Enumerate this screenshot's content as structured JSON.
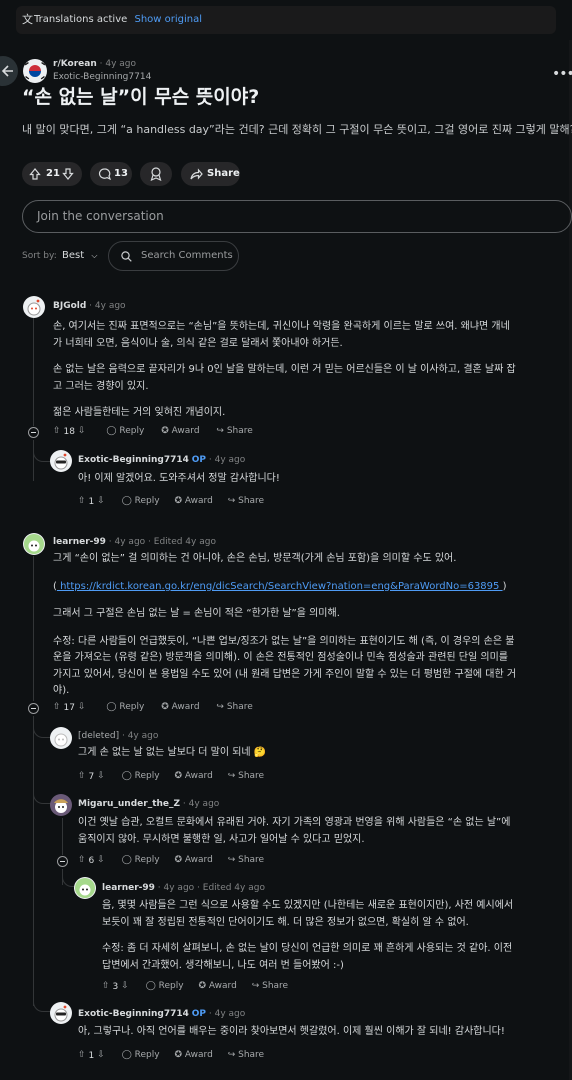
{
  "translation_bar": {
    "label": "Translations active",
    "link": "Show original"
  },
  "post": {
    "subreddit": "r/Korean",
    "time": "4y ago",
    "author": "Exotic-Beginning7714",
    "title": "“손 없는 날”이 무슨 뜻이야?",
    "body": "내 말이 맞다면, 그게 “a handless day”라는 건데? 근데 정확히 그 구절이 무슨 뜻이고, 그걸 영어로 진짜 그렇게 말해?",
    "votes": "21",
    "comments": "13",
    "share_label": "Share"
  },
  "join_placeholder": "Join the conversation",
  "sort": {
    "label": "Sort by:",
    "value": "Best"
  },
  "search_placeholder": "Search Comments",
  "actions": {
    "reply": "Reply",
    "award": "Award",
    "share": "Share"
  },
  "comments": [
    {
      "author": "BJGold",
      "time": "4y ago",
      "op": "",
      "edited": "",
      "lines": [
        "손, 여기서는 진짜 표면적으로는 “손님”을 뜻하는데, 귀신이나 악령을 완곡하게 이르는 말로 쓰여. 왜냐면 개네",
        "가 너희테 오면, 음식이나 술, 의식 같은 걸로 달래서 쫓아내야 하거든.",
        "",
        "손 없는 날은 음력으로 끝자리가 9나 0인 날을 말하는데, 이런 거 믿는 어르신들은 이 날 이사하고, 결혼 날짜 잡",
        "고 그러는 경향이 있지.",
        "",
        "젊은 사람들한테는 거의 잊혀진 개념이지."
      ],
      "votes": "18"
    },
    {
      "author": "Exotic-Beginning7714",
      "time": "4y ago",
      "op": "OP",
      "edited": "",
      "lines": [
        "아! 이제 알겠어요. 도와주셔서 정말 감사합니다!"
      ],
      "votes": "1"
    },
    {
      "author": "learner-99",
      "time": "4y ago",
      "op": "",
      "edited": "Edited 4y ago",
      "lines": [
        "그게 “손이 없는” 걸 의미하는 건 아니야, 손은 손님, 방문객(가게 손님 포함)을 의미할 수도 있어.",
        "",
        "(https://krdict.korean.go.kr/eng/dicSearch/SearchView?nation=eng&ParaWordNo=63895)",
        "",
        "그래서 그 구절은 손님 없는 날 = 손님이 적은 “한가한 날”을 의미해.",
        "",
        "수정: 다른 사람들이 언급했듯이, “나쁜 업보/징조가 없는 날”을 의미하는 표현이기도 해 (즉, 이 경우의 손은 불",
        "운을 가져오는 (유령 같은) 방문객을 의미해). 이 손은 전통적인 점성술이나 민속 점성술과 관련된 단일 의미를",
        "가지고 있어서, 당신이 본 용법일 수도 있어 (내 원래 답변은 가게 주인이 말할 수 있는 더 평범한 구절에 대한 거",
        "야)."
      ],
      "link": " https://krdict.korean.go.kr/eng/dicSearch/SearchView?nation=eng&ParaWordNo=63895 ",
      "votes": "17"
    },
    {
      "author": "[deleted]",
      "time": "4y ago",
      "op": "",
      "edited": "",
      "lines": [
        "그게 손 없는 날 없는 날보다 더 말이 되네 🤔"
      ],
      "votes": "7"
    },
    {
      "author": "Migaru_under_the_Z",
      "time": "4y ago",
      "op": "",
      "edited": "",
      "lines": [
        "이건 옛날 습관, 오컬트 문화에서 유래된 거야. 자기 가족의 영광과 번영을 위해 사람들은 “손 없는 날”에",
        "움직이지 않아. 무시하면 불행한 일, 사고가 일어날 수 있다고 믿었지."
      ],
      "votes": "6"
    },
    {
      "author": "learner-99",
      "time": "4y ago",
      "op": "",
      "edited": "Edited 4y ago",
      "lines": [
        "음, 몇몇 사람들은 그런 식으로 사용할 수도 있겠지만 (나한테는 새로운 표현이지만), 사전 예시에서",
        "보듯이 꽤 잘 정립된 전통적인 단어이기도 해. 더 많은 정보가 없으면, 확실히 알 수 없어.",
        "",
        "수정: 좀 더 자세히 살펴보니, 손 없는 날이 당신이 언급한 의미로 꽤 흔하게 사용되는 것 같아. 이전",
        "답변에서 간과했어. 생각해보니, 나도 여러 번 들어봤어 :-)"
      ],
      "votes": "3"
    },
    {
      "author": "Exotic-Beginning7714",
      "time": "4y ago",
      "op": "OP",
      "edited": "",
      "lines": [
        "아, 그렇구나. 아직 언어를 배우는 중이라 찾아보면서 헷갈렸어. 이제 훨씬 이해가 잘 되네! 감사합니다!"
      ],
      "votes": "1"
    }
  ],
  "colors": {
    "accent": "#4f9cf5",
    "background": "#0e1113",
    "pill": "#272729"
  }
}
